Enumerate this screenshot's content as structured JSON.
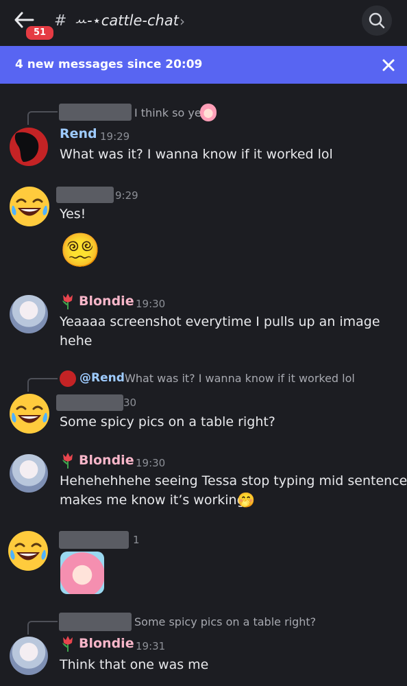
{
  "header": {
    "badge_count": "51",
    "hash": "#",
    "channel_name": "ꕀ-⋆cattle-chat",
    "chevron": "›"
  },
  "banner": {
    "text": "4 new messages since 20:09"
  },
  "colors": {
    "background": "#1c1d22",
    "banner": "#5865f2",
    "badge": "#e53b43",
    "rend_name": "#9ecbff",
    "blondie_name": "#f7b6c9",
    "mention": "#9ecbff"
  },
  "messages": [
    {
      "reply_text": "I think so ye"
    },
    {
      "author": "Rend",
      "time": "19:29",
      "text": "What was it? I wanna know if it worked lol"
    },
    {
      "time": "9:29",
      "text": "Yes!",
      "emoji": "😵‍💫"
    },
    {
      "author": "Blondie",
      "time": "19:30",
      "text_line1": "Yeaaaa screenshot everytime I pulls up an image",
      "text_line2": "hehe"
    },
    {
      "reply_mention": "@Rend",
      "reply_text": "What was it? I wanna know if it worked lol"
    },
    {
      "time": "30",
      "text": "Some spicy pics on a table right?"
    },
    {
      "author": "Blondie",
      "time": "19:30",
      "text_line1": "Hehehehhehe seeing Tessa stop typing mid sentence",
      "text_line2": "makes me know it’s working",
      "emoji": "🤭"
    },
    {
      "time": "1"
    },
    {
      "reply_text": "Some spicy pics on a table right?"
    },
    {
      "author": "Blondie",
      "time": "19:31",
      "text": "Think that one was me"
    }
  ],
  "icons": {
    "back": "arrow-left-icon",
    "search": "search-icon",
    "close": "close-icon",
    "flower": "tulip-icon",
    "laugh": "laughing-face-icon"
  }
}
